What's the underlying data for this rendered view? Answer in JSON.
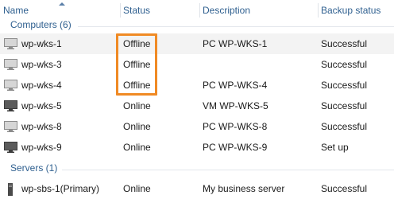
{
  "columns": {
    "name": "Name",
    "status": "Status",
    "description": "Description",
    "backup_status": "Backup status"
  },
  "groups": [
    {
      "label": "Computers (6)"
    },
    {
      "label": "Servers (1)"
    }
  ],
  "rows": [
    {
      "name": "wp-wks-1",
      "status": "Offline",
      "description": "PC WP-WKS-1",
      "backup": "Successful",
      "icon": "pc-offline-icon"
    },
    {
      "name": "wp-wks-3",
      "status": "Offline",
      "description": "",
      "backup": "Successful",
      "icon": "pc-offline-icon"
    },
    {
      "name": "wp-wks-4",
      "status": "Offline",
      "description": "PC WP-WKS-4",
      "backup": "Successful",
      "icon": "pc-offline-icon"
    },
    {
      "name": "wp-wks-5",
      "status": "Online",
      "description": "VM WP-WKS-5",
      "backup": "Successful",
      "icon": "pc-online-icon"
    },
    {
      "name": "wp-wks-8",
      "status": "Online",
      "description": "PC WP-WKS-8",
      "backup": "Successful",
      "icon": "pc-offline-icon"
    },
    {
      "name": "wp-wks-9",
      "status": "Online",
      "description": "PC WP-WKS-9",
      "backup": "Set up",
      "icon": "pc-online-icon"
    },
    {
      "name": "wp-sbs-1(Primary)",
      "status": "Online",
      "description": "My business server",
      "backup": "Successful",
      "icon": "server-icon"
    }
  ],
  "colors": {
    "header_text": "#2e5f8f",
    "highlight_border": "#f08a24",
    "selected_row": "#f3f3f3"
  }
}
